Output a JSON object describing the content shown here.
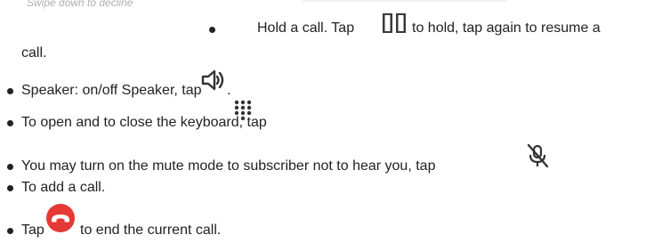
{
  "top_caption": "Swipe down to decline",
  "hold": {
    "text_before": "Hold a call. Tap",
    "text_after": "to hold, tap again to resume a",
    "continuation": "call.",
    "icon": "pause-icon"
  },
  "speaker": {
    "text": "Speaker: on/off Speaker, tap",
    "text_after": ".",
    "icon": "speaker-icon"
  },
  "keyboard": {
    "text": "To open and to close the keyboard, tap",
    "icon": "dialpad-icon"
  },
  "mute": {
    "text": "You may turn on the mute mode to subscriber not to hear you, tap",
    "icon": "mic-off-icon"
  },
  "add_call": {
    "text": "To add a call."
  },
  "end_call": {
    "text_before": "Tap",
    "text_after": "to end the current call.",
    "icon": "end-call-icon",
    "color": "#e53935"
  }
}
